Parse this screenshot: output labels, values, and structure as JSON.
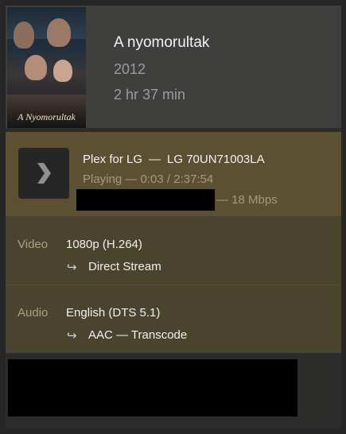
{
  "movie": {
    "title": "A nyomorultak",
    "year": "2012",
    "duration": "2 hr 37 min",
    "poster_title": "A Nyomorultak"
  },
  "session": {
    "player": "Plex for LG",
    "separator": "—",
    "device": "LG 70UN71003LA",
    "progress": "Playing — 0:03 / 2:37:54",
    "bandwidth": "— 18 Mbps",
    "play_icon": "chevron-right-icon"
  },
  "video": {
    "label": "Video",
    "format": "1080p (H.264)",
    "arrow": "↪",
    "method": "Direct Stream"
  },
  "audio": {
    "label": "Audio",
    "format": "English (DTS 5.1)",
    "arrow": "↪",
    "method": "AAC — Transcode"
  },
  "colors": {
    "session_bg": "#5b5031",
    "streams_bg": "#4a442f",
    "header_bg": "#3f3f3d"
  }
}
